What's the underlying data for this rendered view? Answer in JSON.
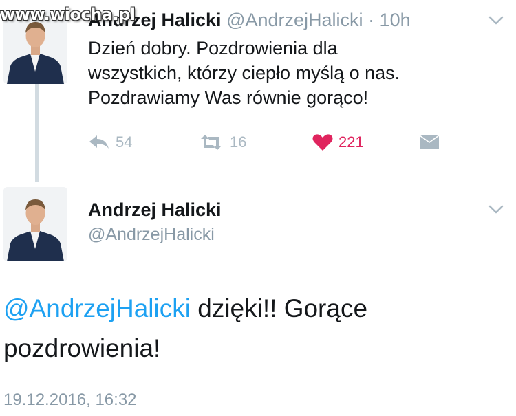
{
  "watermark": "www.wiocha.pl",
  "tweet1": {
    "name": "Andrzej Halicki",
    "handle": "@AndrzejHalicki",
    "time": "· 10h",
    "text_lines": [
      "Dzień dobry. Pozdrowienia dla",
      "wszystkich, którzy ciepło myślą o nas.",
      "Pozdrawiamy Was równie gorąco!"
    ],
    "reply_count": "54",
    "retweet_count": "16",
    "like_count": "221"
  },
  "tweet2": {
    "name": "Andrzej Halicki",
    "handle": "@AndrzejHalicki",
    "mention": "@AndrzejHalicki",
    "text_after_mention": " dzięki!! Gorące",
    "text_line2": "pozdrowienia!",
    "timestamp": "19.12.2016, 16:32"
  },
  "icons": {
    "reply": "reply-icon",
    "retweet": "retweet-icon",
    "like": "heart-icon",
    "dm": "direct-message-icon",
    "caret": "chevron-down-icon"
  },
  "colors": {
    "text": "#14171a",
    "muted": "#8899a6",
    "action": "#aab8c2",
    "like": "#e0245e",
    "link": "#1da1f2"
  }
}
